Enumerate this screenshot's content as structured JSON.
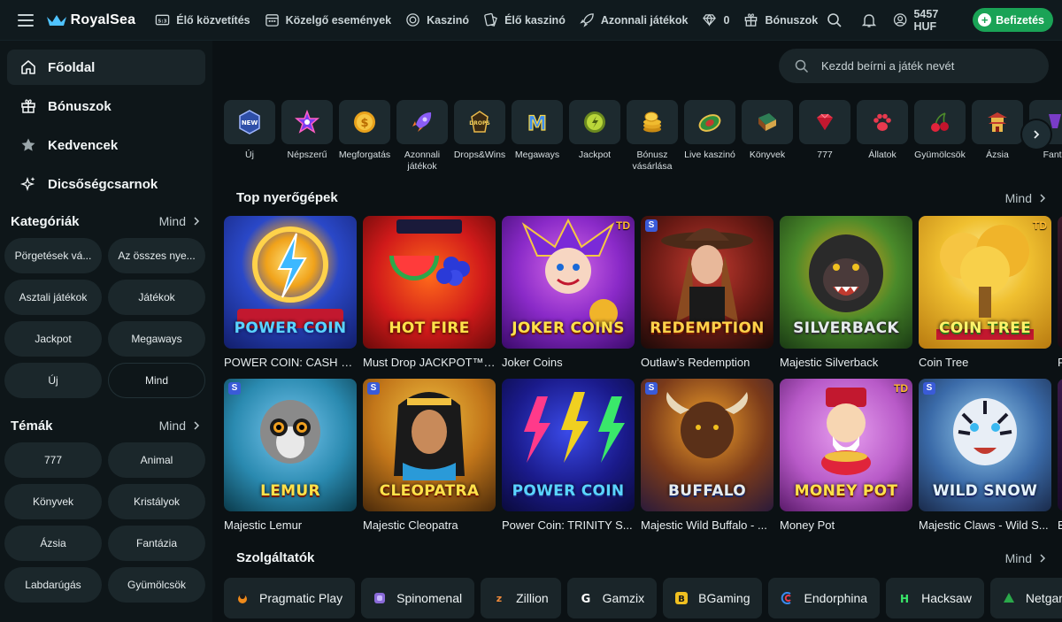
{
  "brand": {
    "name": "RoyalSea"
  },
  "topnav": [
    {
      "label": "Élő közvetítés",
      "icon": "live-tv-icon"
    },
    {
      "label": "Közelgő események",
      "icon": "calendar-icon"
    },
    {
      "label": "Kaszinó",
      "icon": "casino-chip-icon"
    },
    {
      "label": "Élő kaszinó",
      "icon": "live-casino-icon"
    },
    {
      "label": "Azonnali játékok",
      "icon": "rocket-icon"
    },
    {
      "label": "0",
      "icon": "diamond-icon"
    },
    {
      "label": "Bónuszok",
      "icon": "gift-icon"
    }
  ],
  "account": {
    "balance": "5457 HUF",
    "deposit_label": "Befizetés"
  },
  "sidebar": {
    "nav": [
      {
        "label": "Főoldal",
        "icon": "home-icon"
      },
      {
        "label": "Bónuszok",
        "icon": "gift-icon"
      },
      {
        "label": "Kedvencek",
        "icon": "star-icon"
      },
      {
        "label": "Dicsőségcsarnok",
        "icon": "sparkle-icon"
      }
    ],
    "categories": {
      "title": "Kategóriák",
      "more": "Mind",
      "items": [
        "Pörgetések vá...",
        "Az összes nye...",
        "Asztali játékok",
        "Játékok",
        "Jackpot",
        "Megaways",
        "Új",
        "Mind"
      ]
    },
    "themes": {
      "title": "Témák",
      "more": "Mind",
      "items": [
        "777",
        "Animal",
        "Könyvek",
        "Kristályok",
        "Ázsia",
        "Fantázia",
        "Labdarúgás",
        "Gyümölcsök"
      ]
    }
  },
  "search": {
    "placeholder": "Kezdd beírni a játék nevét"
  },
  "game_categories": [
    {
      "label": "Új",
      "icon": "new-badge-icon"
    },
    {
      "label": "Népszerű",
      "icon": "star-burst-icon"
    },
    {
      "label": "Megforgatás",
      "icon": "coin-icon"
    },
    {
      "label": "Azonnali játékok",
      "icon": "rocket-icon"
    },
    {
      "label": "Drops&Wins",
      "icon": "drops-wins-icon"
    },
    {
      "label": "Megaways",
      "icon": "megaways-icon"
    },
    {
      "label": "Jackpot",
      "icon": "jackpot-coin-icon"
    },
    {
      "label": "Bónusz vásárlása",
      "icon": "coin-stack-icon"
    },
    {
      "label": "Live kaszinó",
      "icon": "roulette-icon"
    },
    {
      "label": "Könyvek",
      "icon": "book-icon"
    },
    {
      "label": "777",
      "icon": "ruby-icon"
    },
    {
      "label": "Állatok",
      "icon": "paw-icon"
    },
    {
      "label": "Gyümölcsök",
      "icon": "cherry-icon"
    },
    {
      "label": "Ázsia",
      "icon": "pagoda-icon"
    },
    {
      "label": "Fanta",
      "icon": "fantasy-icon"
    }
  ],
  "top_games": {
    "title": "Top nyerőgépek",
    "more": "Mind",
    "row1": [
      {
        "title": "POWER COIN: CASH UP",
        "art": "POWER COIN",
        "badge": ""
      },
      {
        "title": "Must Drop JACKPOT™ ...",
        "art": "HOT FIRE",
        "badge": ""
      },
      {
        "title": "Joker Coins",
        "art": "JOKER COINS",
        "badge": "TD"
      },
      {
        "title": "Outlaw’s Redemption",
        "art": "REDEMPTION",
        "badge": "S"
      },
      {
        "title": "Majestic Silverback",
        "art": "SILVERBACK",
        "badge": ""
      },
      {
        "title": "Coin Tree",
        "art": "COIN TREE",
        "badge": "TD"
      },
      {
        "title": "F",
        "art": "",
        "badge": ""
      }
    ],
    "row2": [
      {
        "title": "Majestic Lemur",
        "art": "LEMUR",
        "badge": "S"
      },
      {
        "title": "Majestic Cleopatra",
        "art": "CLEOPATRA",
        "badge": "S"
      },
      {
        "title": "Power Coin: TRINITY S...",
        "art": "POWER COIN",
        "badge": ""
      },
      {
        "title": "Majestic Wild Buffalo - ...",
        "art": "BUFFALO",
        "badge": "S"
      },
      {
        "title": "Money Pot",
        "art": "MONEY POT",
        "badge": "TD"
      },
      {
        "title": "Majestic Claws - Wild S...",
        "art": "WILD SNOW",
        "badge": "S"
      },
      {
        "title": "E",
        "art": "",
        "badge": ""
      }
    ]
  },
  "providers": {
    "title": "Szolgáltatók",
    "more": "Mind",
    "items": [
      "Pragmatic Play",
      "Spinomenal",
      "Zillion",
      "Gamzix",
      "BGaming",
      "Endorphina",
      "Hacksaw",
      "Netgam"
    ]
  },
  "colors": {
    "accent_green": "#1aa356",
    "background": "#0b1114",
    "panel": "#1a2529"
  }
}
